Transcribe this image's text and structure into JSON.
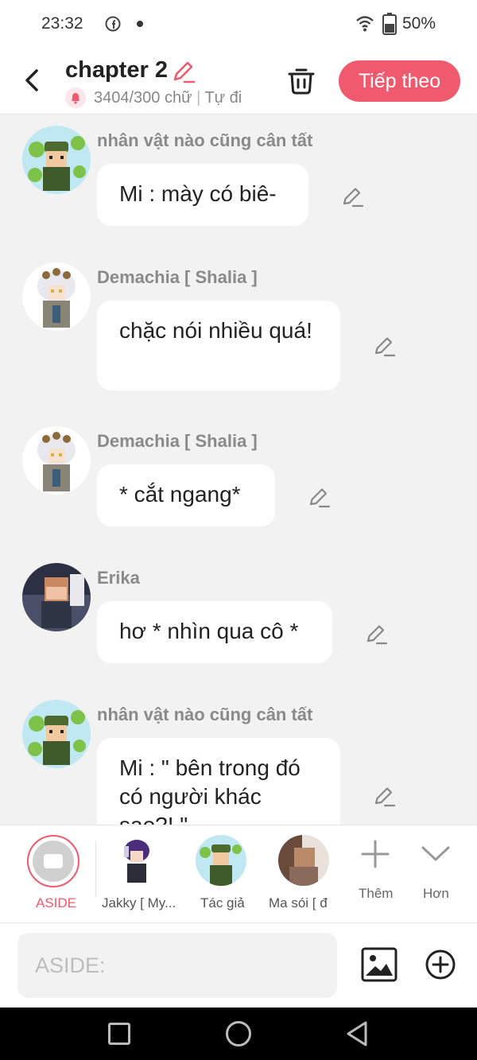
{
  "status_bar": {
    "time": "23:32",
    "battery": "50%"
  },
  "header": {
    "title": "chapter 2",
    "word_count": "3404/300 chữ",
    "mode": "Tự đi",
    "next_label": "Tiếp theo"
  },
  "messages": [
    {
      "sender": "nhân vật nào cũng cân tất",
      "text": "Mi : mày có biê-",
      "avatar": "green-hat-avatar"
    },
    {
      "sender": "Demachia [ Shalia ]",
      "text": "chặc nói nhiều quá!",
      "avatar": "white-hair-avatar"
    },
    {
      "sender": "Demachia [ Shalia ]",
      "text": "* cắt ngang*",
      "avatar": "white-hair-avatar"
    },
    {
      "sender": "Erika",
      "text": "hơ * nhìn qua cô *",
      "avatar": "brown-hair-avatar"
    },
    {
      "sender": "nhân vật nào cũng cân tất",
      "text": "Mi : \" bên trong đó có người khác sao?! \"",
      "avatar": "green-hat-avatar"
    }
  ],
  "character_bar": {
    "aside_label": "ASIDE",
    "characters": [
      {
        "label": "Jakky [ My..."
      },
      {
        "label": "Tác giả"
      },
      {
        "label": "Ma sói [ đ"
      }
    ],
    "add_label": "Thêm",
    "more_label": "Hơn"
  },
  "input": {
    "placeholder": "ASIDE:"
  },
  "colors": {
    "accent": "#f05a6e",
    "background": "#f2f2f2"
  }
}
